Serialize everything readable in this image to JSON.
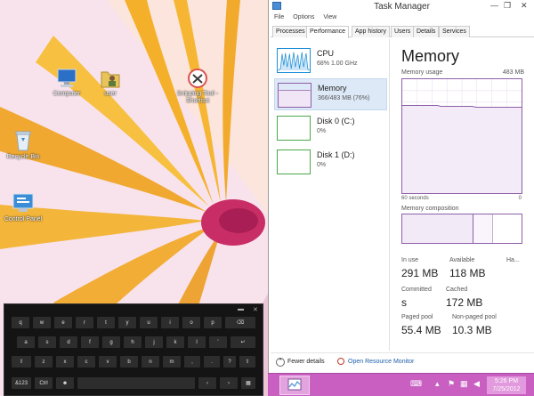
{
  "desktop": {
    "icons": [
      {
        "label": "Computer"
      },
      {
        "label": "user"
      },
      {
        "label": "Snipping Tool - Shortcut"
      },
      {
        "label": "Recycle Bin"
      },
      {
        "label": "Control Panel"
      }
    ]
  },
  "keyboard": {
    "row1": [
      "q",
      "w",
      "e",
      "r",
      "t",
      "y",
      "u",
      "i",
      "o",
      "p"
    ],
    "row2": [
      "a",
      "s",
      "d",
      "f",
      "g",
      "h",
      "j",
      "k",
      "l",
      "'"
    ],
    "row3": [
      "z",
      "x",
      "c",
      "v",
      "b",
      "n",
      "m",
      ",",
      ".",
      "?"
    ],
    "bottom": {
      "num": "&123",
      "ctrl": "Ctrl"
    }
  },
  "taskmanager": {
    "title": "Task Manager",
    "menu": [
      "File",
      "Options",
      "View"
    ],
    "tabs": [
      "Processes",
      "Performance",
      "App history",
      "Users",
      "Details",
      "Services"
    ],
    "active_tab": "Performance",
    "resources": [
      {
        "name": "CPU",
        "sub": "68% 1.00 GHz"
      },
      {
        "name": "Memory",
        "sub": "366/483 MB (76%)"
      },
      {
        "name": "Disk 0 (C:)",
        "sub": "0%"
      },
      {
        "name": "Disk 1 (D:)",
        "sub": "0%"
      }
    ],
    "memory": {
      "title": "Memory",
      "usage_label": "Memory usage",
      "usage_max": "483 MB",
      "time_left": "60 seconds",
      "time_right": "0",
      "composition_label": "Memory composition",
      "stats": {
        "in_use_label": "In use",
        "in_use": "291 MB",
        "available_label": "Available",
        "available": "118 MB",
        "hardware_label": "Ha...",
        "committed_label": "Committed",
        "committed": "s",
        "cached_label": "Cached",
        "cached": "172 MB",
        "paged_label": "Paged pool",
        "paged": "55.4 MB",
        "nonpaged_label": "Non-paged pool",
        "nonpaged": "10.3 MB"
      }
    },
    "footer": {
      "fewer": "Fewer details",
      "monitor": "Open Resource Monitor"
    }
  },
  "taskbar": {
    "time": "5:26 PM",
    "date": "7/25/2012"
  },
  "colors": {
    "accent": "#8e5fa8",
    "taskbar": "#c85fc1",
    "cpu": "#1f8fd6",
    "disk": "#4aa84a"
  }
}
